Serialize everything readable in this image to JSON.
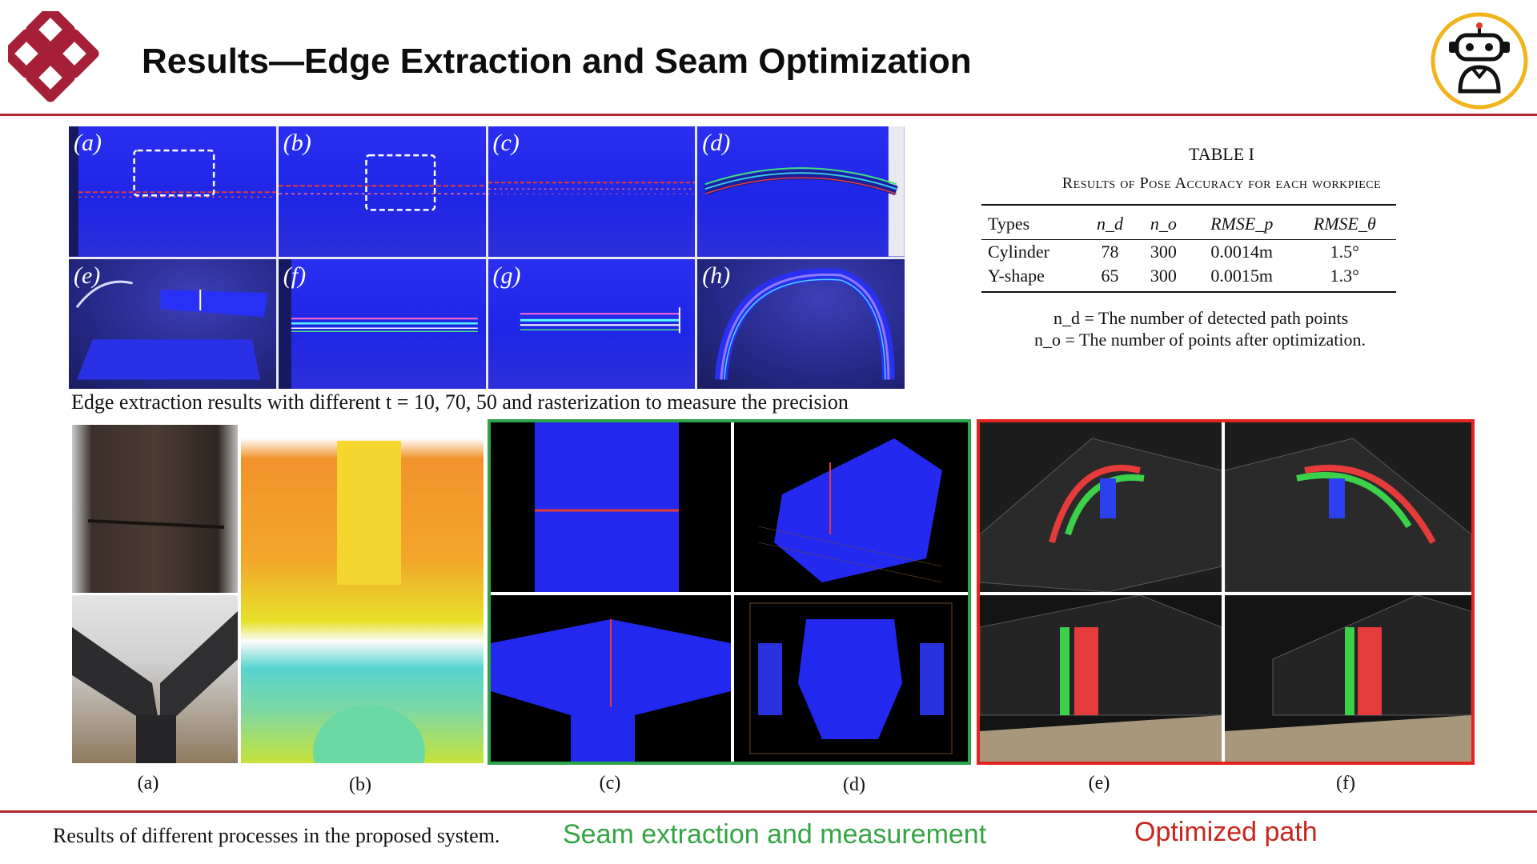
{
  "slide": {
    "title": "Results—Edge Extraction and Seam Optimization",
    "logo_icon": "university-knot-logo-icon",
    "robot_icon": "robot-head-icon",
    "accent_color": "#b3262b"
  },
  "top_panels": {
    "labels": [
      "(a)",
      "(b)",
      "(c)",
      "(d)",
      "(e)",
      "(f)",
      "(g)",
      "(h)"
    ],
    "caption": "Edge extraction results with different t = 10, 70, 50 and rasterization to measure the precision"
  },
  "table": {
    "title": "TABLE I",
    "subtitle": "Results of Pose Accuracy for each workpiece",
    "headers": [
      "Types",
      "n_d",
      "n_o",
      "RMSE_p",
      "RMSE_θ"
    ],
    "rows": [
      [
        "Cylinder",
        "78",
        "300",
        "0.0014m",
        "1.5°"
      ],
      [
        "Y-shape",
        "65",
        "300",
        "0.0015m",
        "1.3°"
      ]
    ],
    "notes": [
      "n_d = The number of detected path points",
      "n_o = The number of points after optimization."
    ]
  },
  "bottom_panels": {
    "labels": [
      "(a)",
      "(b)",
      "(c)",
      "(d)",
      "(e)",
      "(f)"
    ],
    "caption": "Results of different processes in the proposed system.",
    "seam_caption": "Seam extraction and measurement",
    "seam_color": "#33a544",
    "path_caption": "Optimized path",
    "path_color": "#c8261f"
  }
}
